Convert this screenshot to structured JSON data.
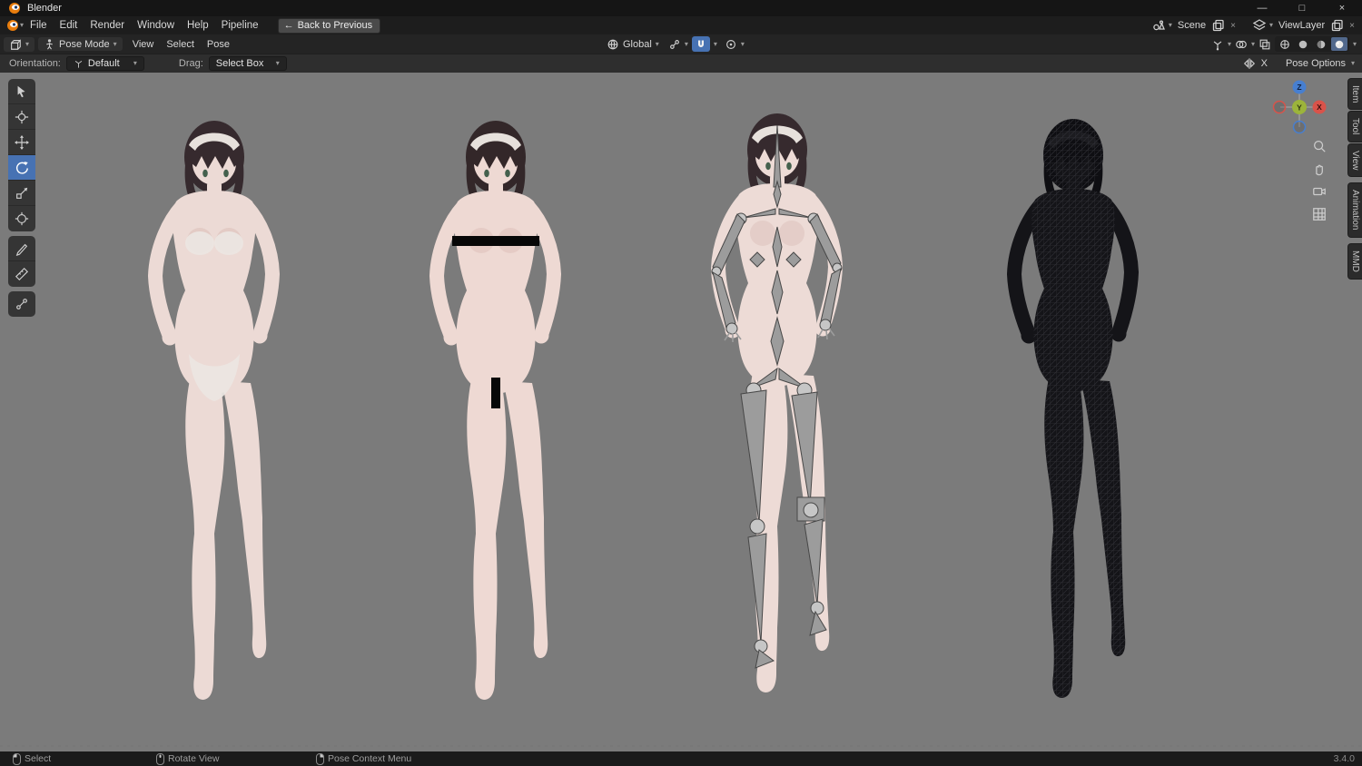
{
  "window": {
    "title": "Blender",
    "min_icon": "—",
    "max_icon": "□",
    "close_icon": "×"
  },
  "icons": {
    "chevron": "▾",
    "back_arrow": "←",
    "close": "×"
  },
  "menubar": {
    "items": [
      "File",
      "Edit",
      "Render",
      "Window",
      "Help",
      "Pipeline"
    ],
    "back_button": "Back to Previous",
    "scene_label": "Scene",
    "viewlayer_label": "ViewLayer"
  },
  "viewport_header": {
    "mode": "Pose Mode",
    "menus": [
      "View",
      "Select",
      "Pose"
    ],
    "orientation": "Global"
  },
  "tool_settings": {
    "orientation_label": "Orientation:",
    "orientation_value": "Default",
    "drag_label": "Drag:",
    "drag_value": "Select Box",
    "mirror_x": "X",
    "pose_options_label": "Pose Options"
  },
  "left_toolbar": {
    "tools": [
      "tweak",
      "cursor",
      "move",
      "rotate",
      "scale",
      "transform",
      "annotate",
      "measure",
      "pose-breakdowner"
    ],
    "active_tool": "rotate"
  },
  "gizmo": {
    "x": "X",
    "y": "Y",
    "z": "Z"
  },
  "sidebar_tabs": [
    "Item",
    "Tool",
    "View",
    "Animation",
    "MMD"
  ],
  "figures": [
    {
      "name": "character-model-textured"
    },
    {
      "name": "character-model-censored"
    },
    {
      "name": "character-model-armature"
    },
    {
      "name": "character-model-wireframe"
    }
  ],
  "statusbar": {
    "select": "Select",
    "rotate_view": "Rotate View",
    "context_menu": "Pose Context Menu",
    "version": "3.4.0"
  },
  "colors": {
    "accent_blue": "#4772b3",
    "viewport_bg": "#7b7b7b",
    "skin": "#ecdad5",
    "hair": "#362a2e",
    "axis_x": "#d9534a",
    "axis_y": "#9cb43b",
    "axis_z": "#477fd0"
  }
}
